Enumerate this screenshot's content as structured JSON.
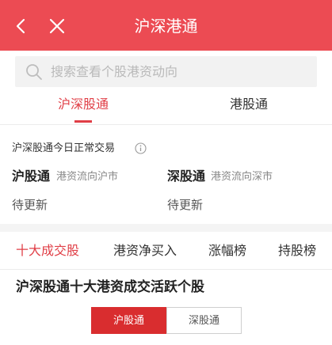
{
  "header": {
    "title": "沪深港通",
    "back_icon": "chevron-left-icon",
    "close_icon": "close-icon",
    "bg_color": "#ec4b53"
  },
  "search": {
    "placeholder": "搜索查看个股港资动向",
    "icon": "search-icon"
  },
  "tabs": [
    {
      "label": "沪深股通",
      "active": true
    },
    {
      "label": "港股通",
      "active": false
    }
  ],
  "status": {
    "text": "沪深股通今日正常交易",
    "icon": "info-icon"
  },
  "flows": [
    {
      "name": "沪股通",
      "sub": "港资流向沪市",
      "value": "待更新"
    },
    {
      "name": "深股通",
      "sub": "港资流向深市",
      "value": "待更新"
    }
  ],
  "rank_tabs": [
    {
      "label": "十大成交股",
      "active": true
    },
    {
      "label": "港资净买入",
      "active": false
    },
    {
      "label": "涨幅榜",
      "active": false
    },
    {
      "label": "持股榜",
      "active": false
    }
  ],
  "section": {
    "title": "沪深股通十大港资成交活跃个股"
  },
  "segments": [
    {
      "label": "沪股通",
      "active": true
    },
    {
      "label": "深股通",
      "active": false
    }
  ],
  "colors": {
    "accent": "#e03e46",
    "segment_active": "#d92d2f"
  }
}
